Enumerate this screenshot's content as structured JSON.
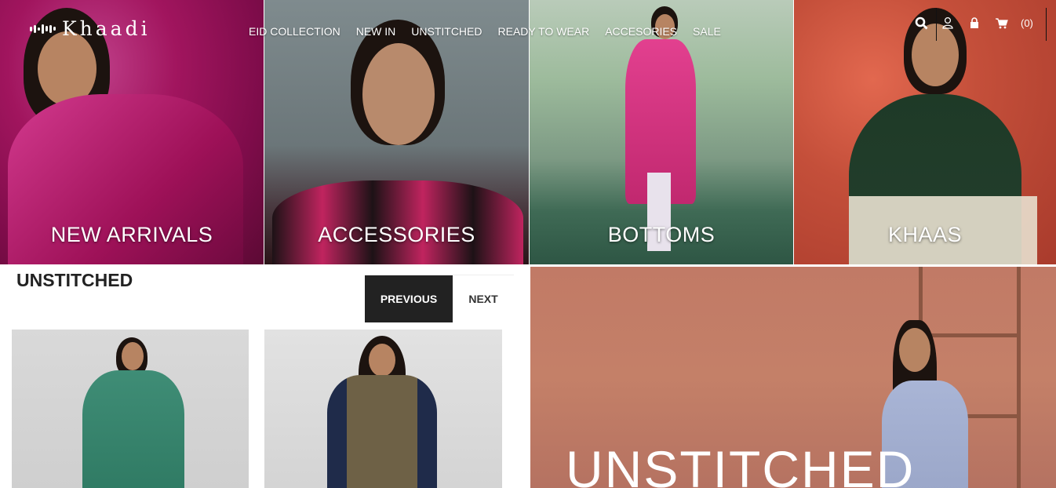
{
  "brand": {
    "name": "Khaadi"
  },
  "nav": {
    "items": [
      "EID COLLECTION",
      "NEW IN",
      "UNSTITCHED",
      "READY TO WEAR",
      "ACCESORIES",
      "SALE"
    ]
  },
  "header_icons": [
    "search-icon",
    "user-icon",
    "lock-icon",
    "cart-icon"
  ],
  "cart": {
    "count_label": "(0)"
  },
  "hero_tiles": [
    {
      "label": "NEW ARRIVALS"
    },
    {
      "label": "ACCESSORIES"
    },
    {
      "label": "BOTTOMS"
    },
    {
      "label": "KHAAS"
    }
  ],
  "section": {
    "title": "UNSTITCHED",
    "prev_label": "PREVIOUS",
    "next_label": "NEXT"
  },
  "banner": {
    "title": "UNSTITCHED"
  },
  "colors": {
    "accent_dark": "#222222",
    "banner_bg": "#c17a66",
    "text_light": "#ffffff"
  }
}
